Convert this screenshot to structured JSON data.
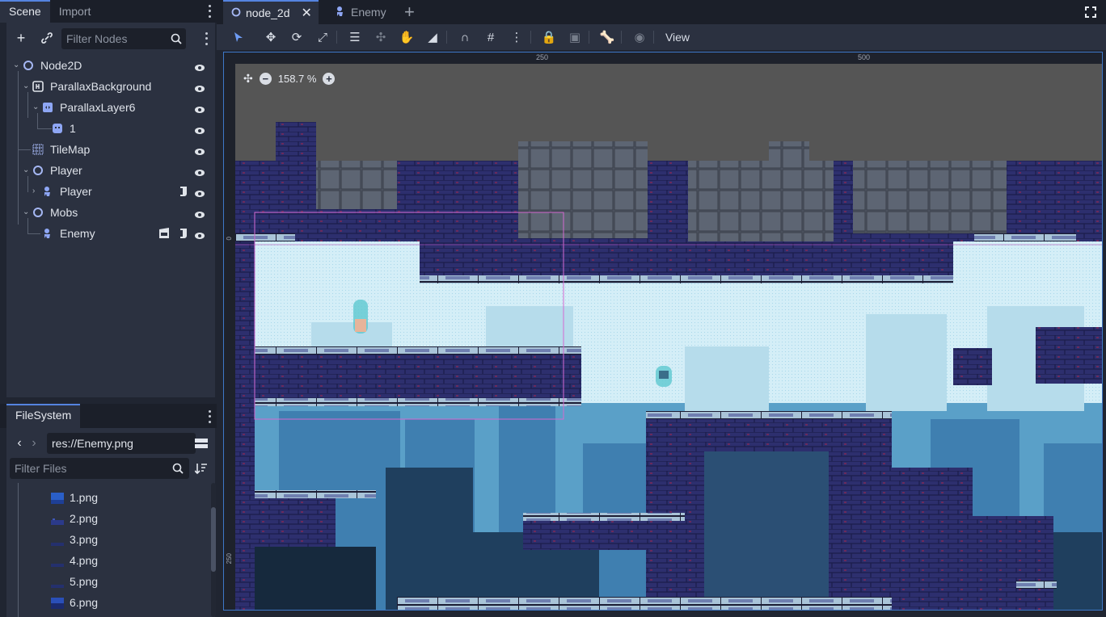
{
  "scene_dock": {
    "tabs": [
      {
        "label": "Scene"
      },
      {
        "label": "Import"
      }
    ],
    "filter_placeholder": "Filter Nodes",
    "nodes": [
      {
        "label": "Node2D",
        "icon": "node2d-icon"
      },
      {
        "label": "ParallaxBackground",
        "icon": "parallax-background-icon"
      },
      {
        "label": "ParallaxLayer6",
        "icon": "parallax-layer-icon"
      },
      {
        "label": "1",
        "icon": "sprite-icon"
      },
      {
        "label": "TileMap",
        "icon": "tilemap-icon"
      },
      {
        "label": "Player",
        "icon": "node2d-icon"
      },
      {
        "label": "Player",
        "icon": "character-icon"
      },
      {
        "label": "Mobs",
        "icon": "node2d-icon"
      },
      {
        "label": "Enemy",
        "icon": "character-icon"
      }
    ]
  },
  "filesystem_dock": {
    "tab": "FileSystem",
    "path": "res://Enemy.png",
    "filter_placeholder": "Filter Files",
    "files": [
      {
        "label": "1.png"
      },
      {
        "label": "2.png"
      },
      {
        "label": "3.png"
      },
      {
        "label": "4.png"
      },
      {
        "label": "5.png"
      },
      {
        "label": "6.png"
      }
    ]
  },
  "editor": {
    "tabs": [
      {
        "label": "node_2d"
      },
      {
        "label": "Enemy"
      }
    ],
    "view_menu": "View",
    "zoom": "158.7 %",
    "ruler_ticks": [
      "250",
      "500"
    ],
    "ruler_left_ticks": [
      "0",
      "250"
    ]
  },
  "colors": {
    "accent": "#5584e0",
    "panel": "#2b3140",
    "background": "#202531",
    "sky": "#cfeef6",
    "brick": "#2d2f6e",
    "stone": "#a9c4d8"
  }
}
